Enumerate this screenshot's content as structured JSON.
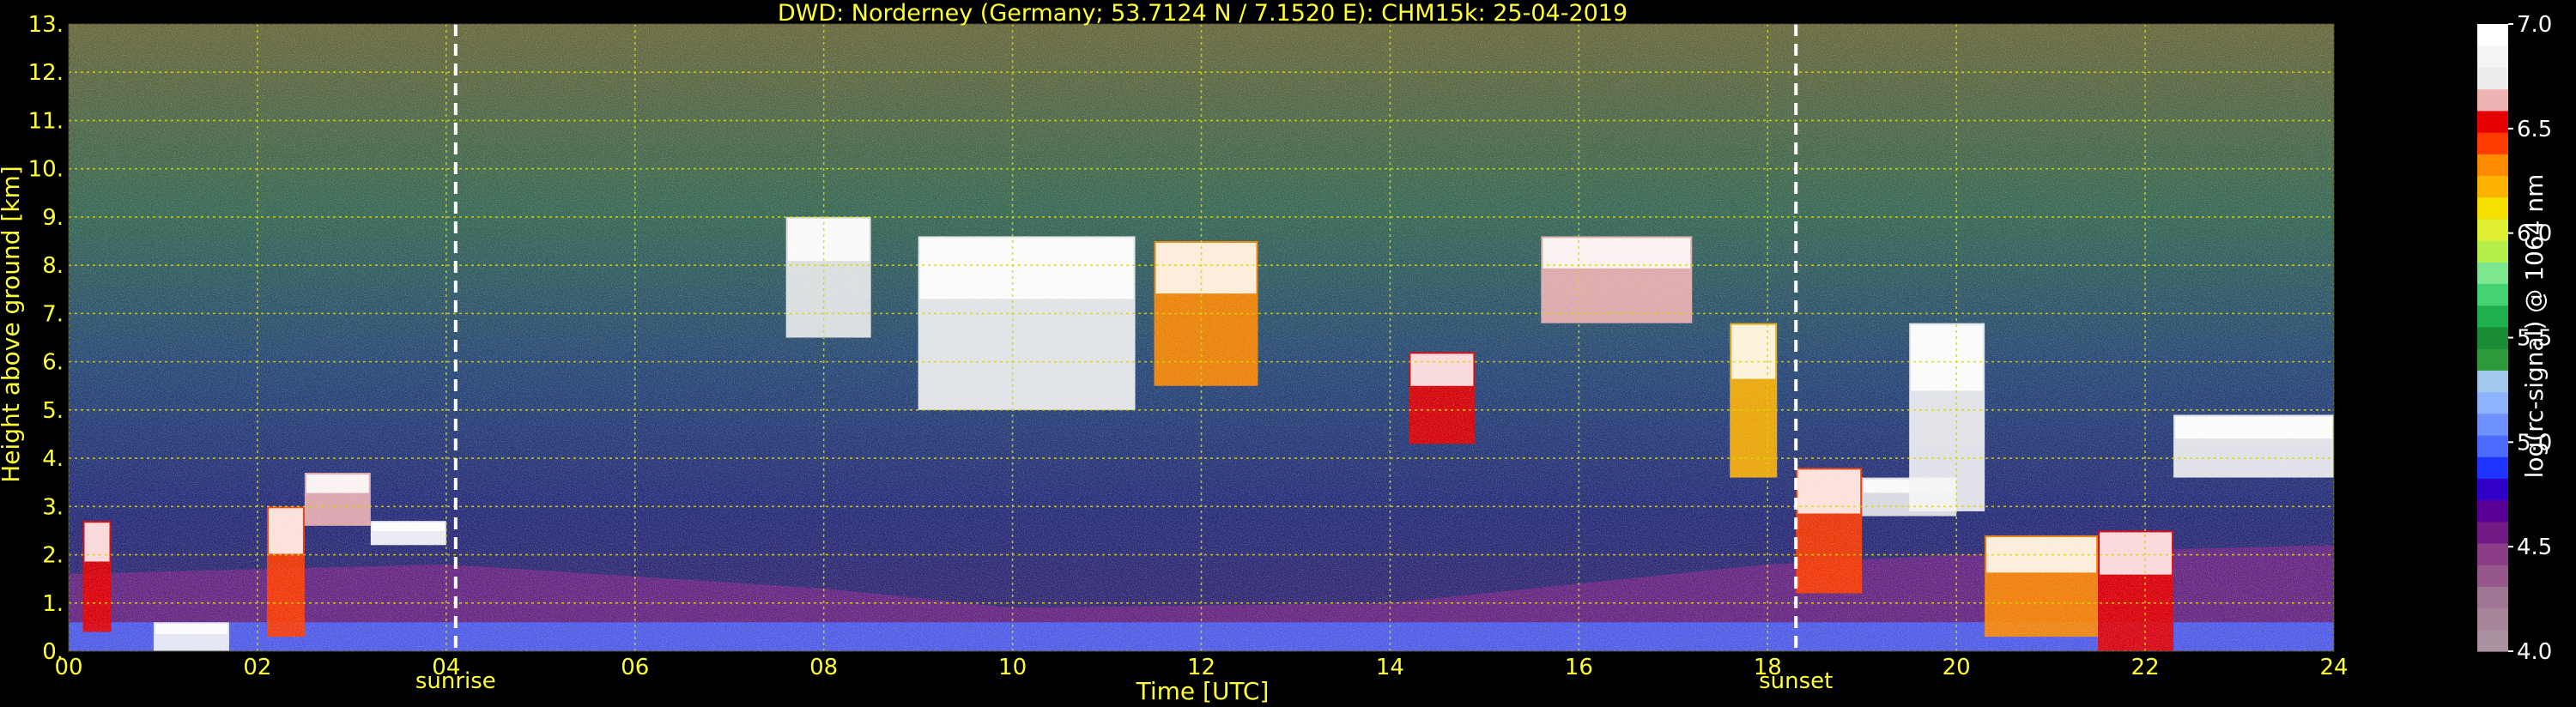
{
  "chart_data": {
    "type": "heatmap",
    "title": "DWD: Norderney (Germany; 53.7124 N / 7.1520 E):    CHM15k: 25-04-2019",
    "xlabel": "Time [UTC]",
    "ylabel": "Height above ground [km]",
    "xlim": [
      0,
      24
    ],
    "ylim": [
      0,
      13
    ],
    "x_ticks": [
      "00",
      "02",
      "04",
      "06",
      "08",
      "10",
      "12",
      "14",
      "16",
      "18",
      "20",
      "22",
      "24"
    ],
    "y_ticks": [
      "0.",
      "1.",
      "2.",
      "3.",
      "4.",
      "5.",
      "6.",
      "7.",
      "8.",
      "9.",
      "10.",
      "11.",
      "12.",
      "13."
    ],
    "grid": true,
    "annotations": [
      {
        "label": "sunrise",
        "x": 4.1
      },
      {
        "label": "sunset",
        "x": 18.3
      }
    ],
    "colorbar": {
      "label": "log(rc-signal) @ 1064 nm",
      "range": [
        4.0,
        7.0
      ],
      "ticks": [
        "4.0",
        "4.5",
        "5.0",
        "5.5",
        "6.0",
        "6.5",
        "7.0"
      ],
      "colors": [
        "#a9919f",
        "#a6849a",
        "#a17594",
        "#96588c",
        "#8a3d86",
        "#741a84",
        "#5a0097",
        "#3000c8",
        "#1f35ff",
        "#4c6cff",
        "#6f92ff",
        "#8fb2ff",
        "#a2c8ee",
        "#2c9c3a",
        "#1a8c36",
        "#20b050",
        "#45d273",
        "#7ee68f",
        "#b6ee4a",
        "#e2f032",
        "#f5e000",
        "#ffb300",
        "#ff8a00",
        "#ff3c00",
        "#e60000",
        "#f0b3b3",
        "#ececec",
        "#f4f4f4",
        "#ffffff"
      ]
    },
    "features": {
      "aerosol_layer_top_km": [
        {
          "x": 0,
          "y": 1.6
        },
        {
          "x": 4,
          "y": 1.8
        },
        {
          "x": 8,
          "y": 1.3
        },
        {
          "x": 10,
          "y": 0.9
        },
        {
          "x": 14,
          "y": 1.0
        },
        {
          "x": 18,
          "y": 1.8
        },
        {
          "x": 20,
          "y": 2.0
        },
        {
          "x": 24,
          "y": 2.2
        }
      ],
      "cloud_segments": [
        {
          "x0": 0.15,
          "x1": 0.45,
          "y0": 0.4,
          "y1": 2.7,
          "level": 6.5
        },
        {
          "x0": 0.9,
          "x1": 1.7,
          "y0": 0.0,
          "y1": 0.6,
          "level": 6.8
        },
        {
          "x0": 2.1,
          "x1": 2.5,
          "y0": 0.3,
          "y1": 3.0,
          "level": 6.4
        },
        {
          "x0": 2.5,
          "x1": 3.2,
          "y0": 2.6,
          "y1": 3.7,
          "level": 6.6
        },
        {
          "x0": 3.2,
          "x1": 4.0,
          "y0": 2.2,
          "y1": 2.7,
          "level": 6.9
        },
        {
          "x0": 7.6,
          "x1": 8.5,
          "y0": 6.5,
          "y1": 9.0,
          "level": 6.7
        },
        {
          "x0": 9.0,
          "x1": 11.3,
          "y0": 5.0,
          "y1": 8.6,
          "level": 6.8
        },
        {
          "x0": 11.5,
          "x1": 12.6,
          "y0": 5.5,
          "y1": 8.5,
          "level": 6.3
        },
        {
          "x0": 14.2,
          "x1": 14.9,
          "y0": 4.3,
          "y1": 6.2,
          "level": 6.5
        },
        {
          "x0": 15.6,
          "x1": 17.2,
          "y0": 6.8,
          "y1": 8.6,
          "level": 6.6
        },
        {
          "x0": 17.6,
          "x1": 18.1,
          "y0": 3.6,
          "y1": 6.8,
          "level": 6.2
        },
        {
          "x0": 18.3,
          "x1": 19.0,
          "y0": 1.2,
          "y1": 3.8,
          "level": 6.4
        },
        {
          "x0": 19.0,
          "x1": 20.0,
          "y0": 2.8,
          "y1": 3.6,
          "level": 6.7
        },
        {
          "x0": 19.5,
          "x1": 20.3,
          "y0": 2.9,
          "y1": 6.8,
          "level": 6.8
        },
        {
          "x0": 20.3,
          "x1": 21.5,
          "y0": 0.3,
          "y1": 2.4,
          "level": 6.3
        },
        {
          "x0": 21.5,
          "x1": 22.3,
          "y0": 0.0,
          "y1": 2.5,
          "level": 6.5
        },
        {
          "x0": 22.3,
          "x1": 24.0,
          "y0": 3.6,
          "y1": 4.9,
          "level": 6.8
        }
      ]
    }
  }
}
